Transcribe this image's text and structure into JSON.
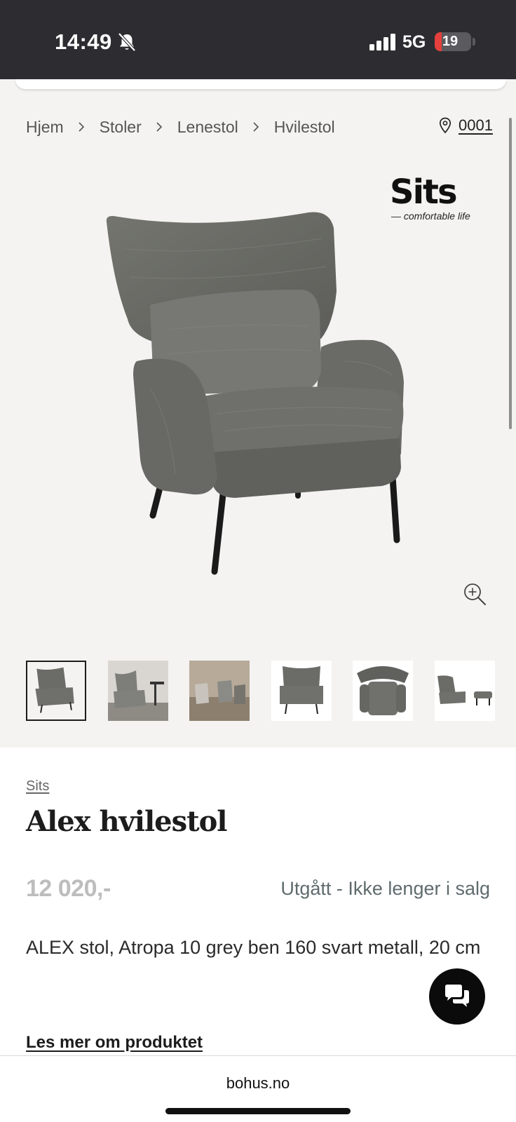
{
  "status_bar": {
    "time": "14:49",
    "network": "5G",
    "battery": {
      "percent_label": "19",
      "level": 0.19,
      "color": "#e5403b"
    }
  },
  "breadcrumb": {
    "items": [
      "Hjem",
      "Stoler",
      "Lenestol",
      "Hvilestol"
    ],
    "separator_icon": "chevron-right-icon"
  },
  "store": {
    "icon": "location-pin-icon",
    "code": "0001"
  },
  "brand_logo": {
    "word": "Sits",
    "tagline": "— comfortable life"
  },
  "gallery": {
    "zoom_icon": "zoom-in-icon",
    "thumbnail_count": 6,
    "active_thumbnail": 1
  },
  "product": {
    "brand": "Sits",
    "title": "Alex hvilestol",
    "price": "12 020,-",
    "availability": "Utgått - Ikke lenger i salg",
    "description": "ALEX stol, Atropa 10 grey ben 160 svart metall, 20 cm",
    "read_more": "Les mer om produktet"
  },
  "chat": {
    "icon": "chat-bubbles-icon"
  },
  "browser": {
    "url": "bohus.no"
  },
  "colors": {
    "status_bar_bg": "#2d2d31",
    "gallery_bg": "#f4f3f1",
    "chair_fabric": "#6b6c67",
    "availability_text": "#5f6b6d",
    "price_text": "#bdbdbd"
  }
}
